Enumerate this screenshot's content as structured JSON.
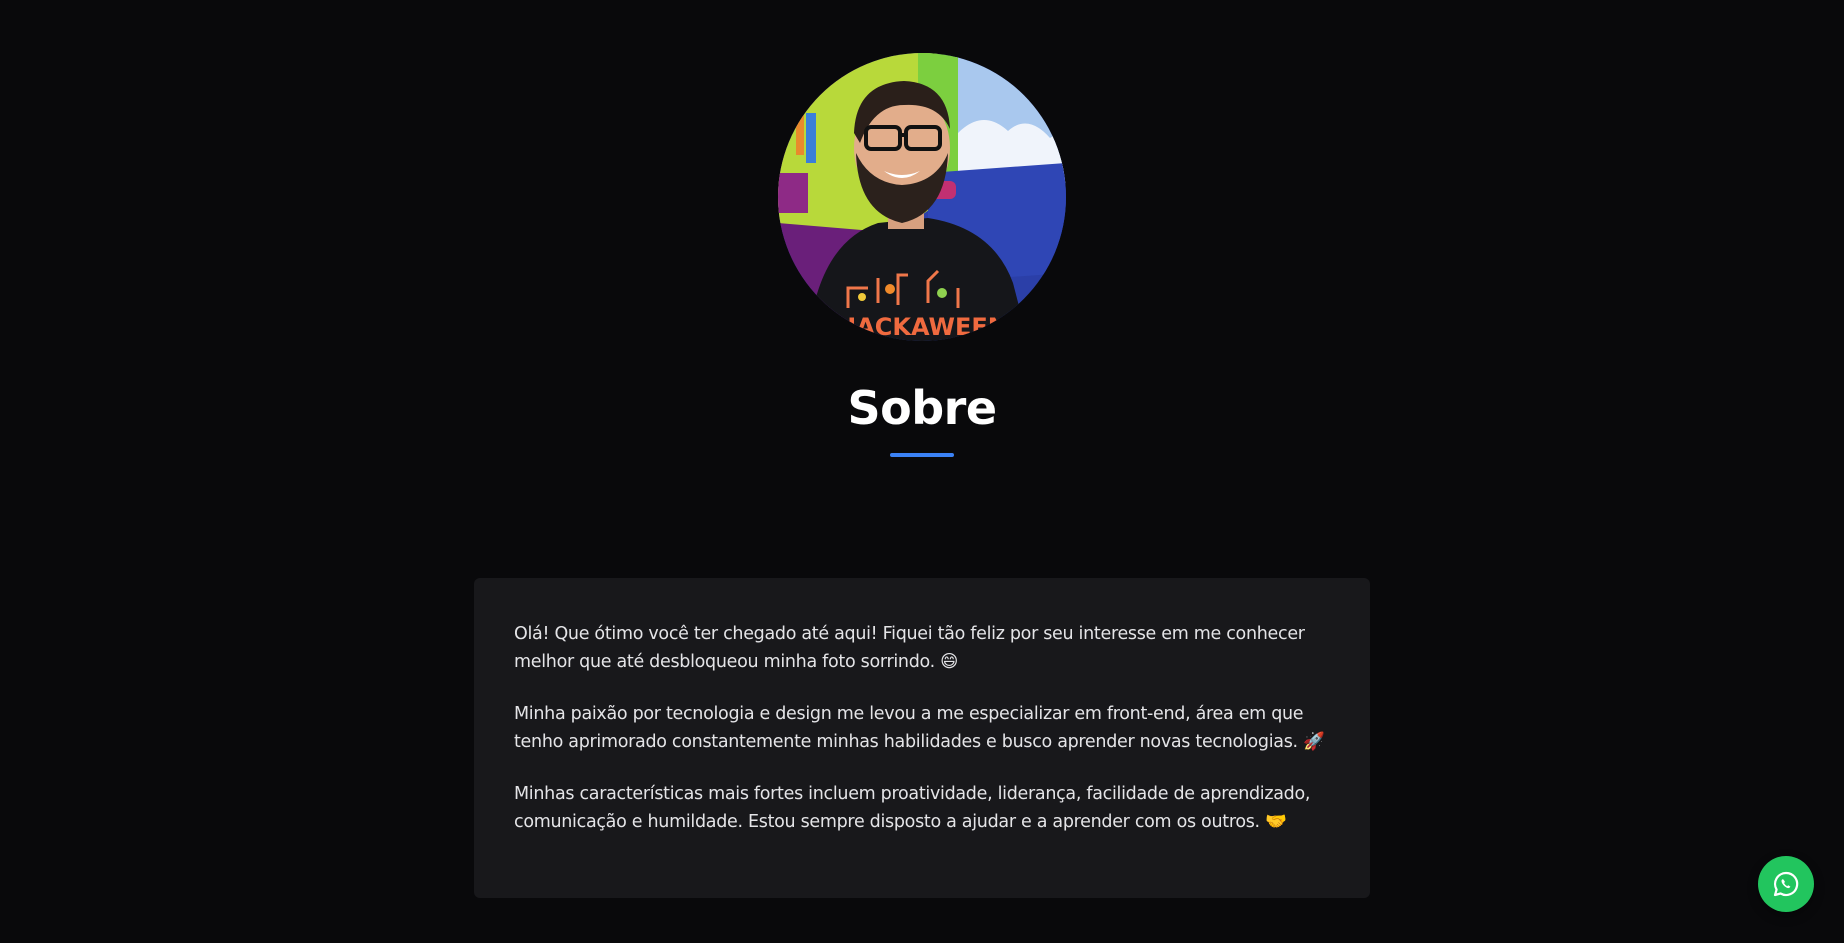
{
  "about": {
    "title": "Sobre",
    "paragraphs": [
      "Olá! Que ótimo você ter chegado até aqui! Fiquei tão feliz por seu interesse em me conhecer melhor que até desbloqueou minha foto sorrindo. 😄",
      "Minha paixão por tecnologia e design me levou a me especializar em front-end, área em que tenho aprimorado constantemente minhas habilidades e busco aprender novas tecnologias. 🚀",
      "Minhas características mais fortes incluem proatividade, liderança, facilidade de aprendizado, comunicação e humildade. Estou sempre disposto a ajudar e a aprender com os outros. 🤝"
    ]
  },
  "avatar": {
    "shirt_text": "HACKAWEEN",
    "icon": "profile-photo"
  },
  "whatsapp": {
    "icon": "whatsapp-icon"
  },
  "colors": {
    "background": "#09090b",
    "card": "#18181b",
    "accent": "#3b82f6",
    "whatsapp": "#22c55e"
  }
}
